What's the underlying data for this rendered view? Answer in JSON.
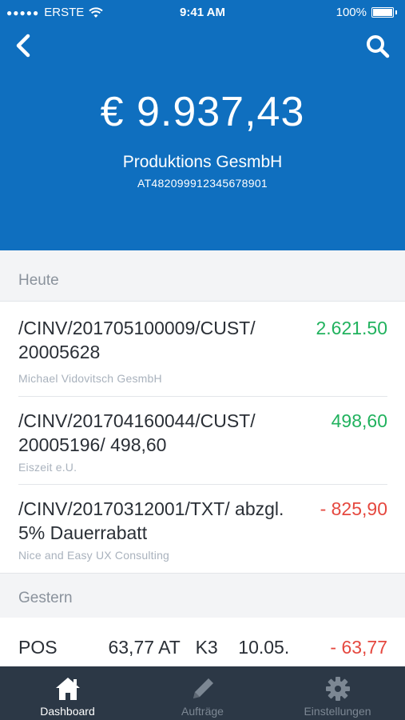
{
  "status_bar": {
    "carrier": "ERSTE",
    "time": "9:41 AM",
    "battery": "100%"
  },
  "header": {
    "balance": "€ 9.937,43",
    "account_name": "Produktions GesmbH",
    "iban": "AT482099912345678901",
    "background_color": "#0f6fbf"
  },
  "sections": [
    {
      "label": "Heute",
      "transactions": [
        {
          "description": "/CINV/201705100009/CUST/ 20005628",
          "counterparty": "Michael Vidovitsch GesmbH",
          "amount": "2.621.50",
          "direction": "positive"
        },
        {
          "description": "/CINV/201704160044/CUST/ 20005196/ 498,60",
          "counterparty": "Eiszeit e.U.",
          "amount": "498,60",
          "direction": "positive"
        },
        {
          "description": "/CINV/20170312001/TXT/ abzgl. 5% Dauerrabatt",
          "counterparty": "Nice and Easy UX Consulting",
          "amount": "- 825,90",
          "direction": "negative"
        }
      ]
    },
    {
      "label": "Gestern",
      "transactions": [
        {
          "description": "POS          63,77 AT   K3    10.05.",
          "amount": "- 63,77",
          "direction": "negative"
        }
      ]
    }
  ],
  "tab_bar": {
    "tabs": [
      {
        "label": "Dashboard",
        "icon": "home-icon",
        "active": true
      },
      {
        "label": "Aufträge",
        "icon": "pencil-icon",
        "active": false
      },
      {
        "label": "Einstellungen",
        "icon": "gear-icon",
        "active": false
      }
    ]
  },
  "colors": {
    "positive": "#21b25e",
    "negative": "#e5483f",
    "tab_bar": "#2c3846"
  }
}
